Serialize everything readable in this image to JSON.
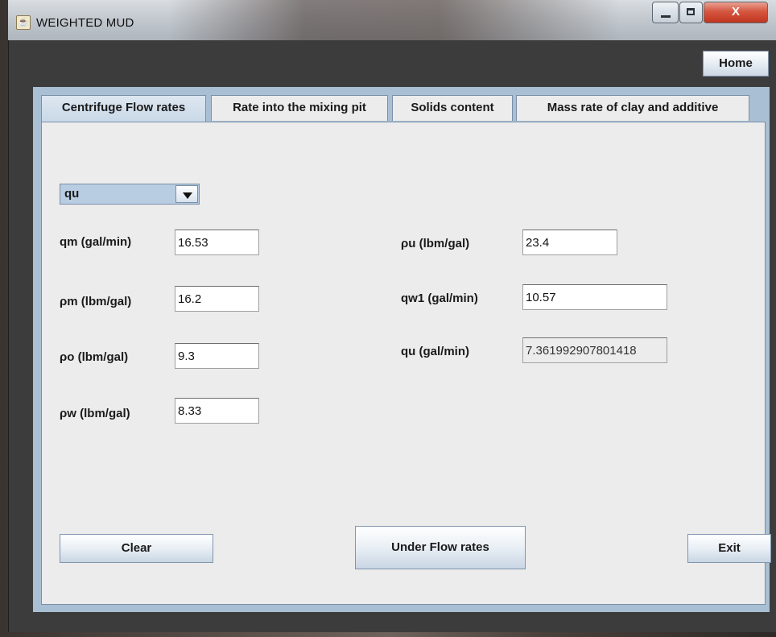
{
  "window": {
    "title": "WEIGHTED MUD",
    "controls": {
      "minimize": "",
      "maximize": "",
      "close": "X"
    }
  },
  "toolbar": {
    "home_label": "Home"
  },
  "tabs": [
    {
      "label": "Centrifuge Flow rates",
      "active": true
    },
    {
      "label": "Rate into the mixing pit",
      "active": false
    },
    {
      "label": "Solids content",
      "active": false
    },
    {
      "label": "Mass rate of clay and additive",
      "active": false
    }
  ],
  "form": {
    "selector": {
      "value": "qu"
    },
    "left_fields": [
      {
        "label": "qm (gal/min)",
        "value": "16.53"
      },
      {
        "label": "ρm (lbm/gal)",
        "value": "16.2"
      },
      {
        "label": "ρo (lbm/gal)",
        "value": "9.3"
      },
      {
        "label": "ρw (lbm/gal)",
        "value": "8.33"
      }
    ],
    "right_fields": [
      {
        "label": "ρu (lbm/gal)",
        "value": "23.4"
      },
      {
        "label": "qw1 (gal/min)",
        "value": "10.57"
      },
      {
        "label": "qu (gal/min)",
        "value": "7.361992907801418"
      }
    ]
  },
  "buttons": {
    "clear": "Clear",
    "compute": "Under Flow rates",
    "exit": "Exit"
  },
  "colors": {
    "panel_border": "#a9bfd3",
    "close_button": "#c1351f",
    "frame": "#3c3c3c"
  }
}
